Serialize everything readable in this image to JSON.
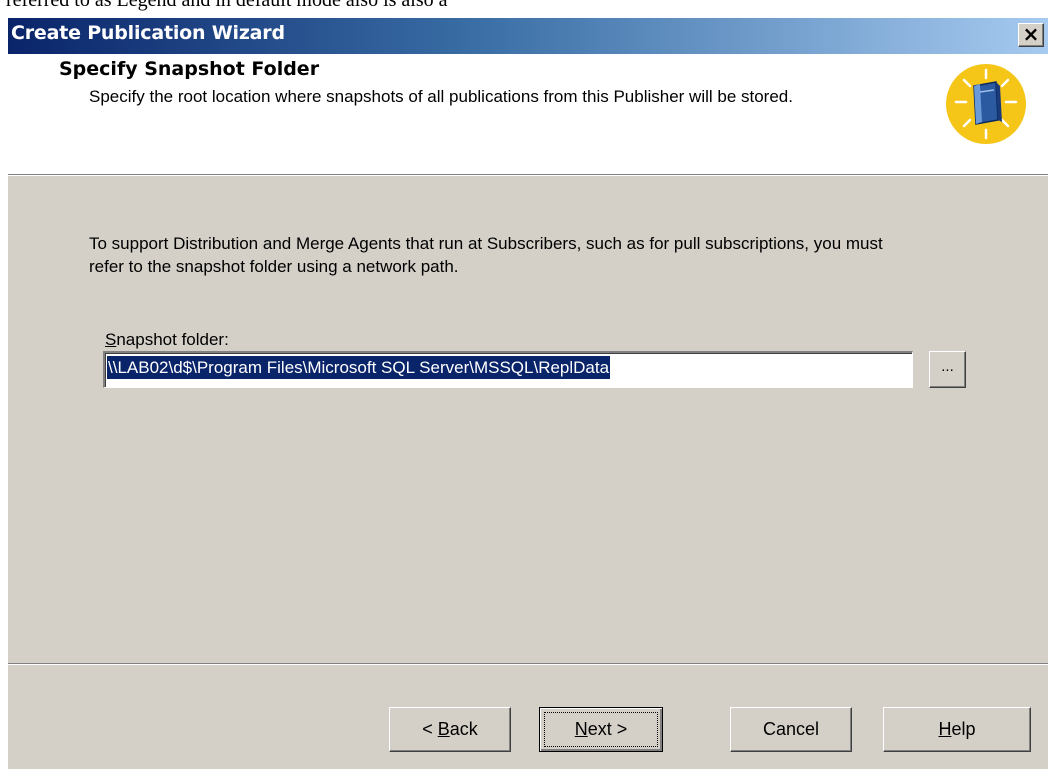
{
  "top_text": "referred to as Legend and in default mode also is also a",
  "window": {
    "title": "Create Publication Wizard",
    "close_label": "×"
  },
  "header": {
    "title": "Specify Snapshot Folder",
    "description": "Specify the root location where snapshots of all publications from this Publisher will be stored.",
    "icon": "wizard-book-icon"
  },
  "body": {
    "intro": "To support Distribution and Merge Agents that run at Subscribers, such as for pull subscriptions, you must refer to the snapshot folder using a network path.",
    "folder_label_mnemonic": "S",
    "folder_label_rest": "napshot folder:",
    "folder_value": "\\\\LAB02\\d$\\Program Files\\Microsoft SQL Server\\MSSQL\\ReplData",
    "browse_label": "..."
  },
  "footer": {
    "back_prefix": "< ",
    "back_mnemonic": "B",
    "back_rest": "ack",
    "next_mnemonic": "N",
    "next_rest": "ext >",
    "cancel_label": "Cancel",
    "help_mnemonic": "H",
    "help_rest": "elp"
  }
}
